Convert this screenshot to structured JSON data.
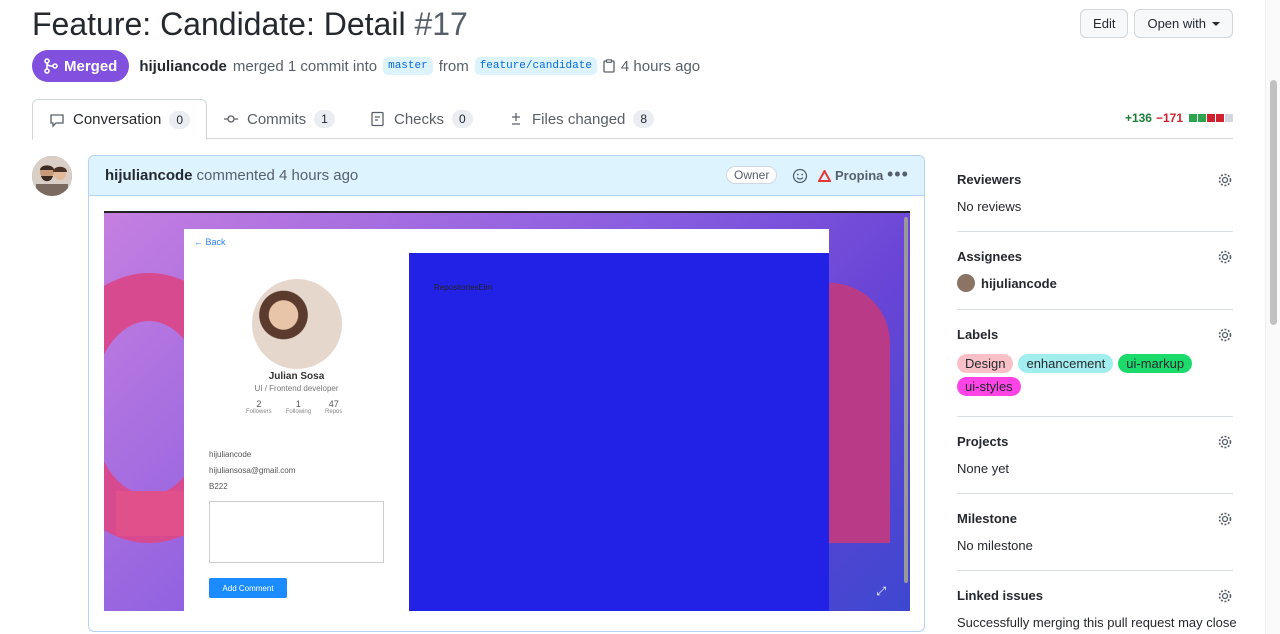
{
  "pr": {
    "title": "Feature: Candidate: Detail",
    "number": "#17",
    "status": "Merged",
    "author": "hijuliancode",
    "action": "merged 1 commit into",
    "base_branch": "master",
    "from_word": "from",
    "head_branch": "feature/candidate",
    "time": "4 hours ago"
  },
  "actions": {
    "edit": "Edit",
    "open_with": "Open with"
  },
  "tabs": [
    {
      "label": "Conversation",
      "count": "0"
    },
    {
      "label": "Commits",
      "count": "1"
    },
    {
      "label": "Checks",
      "count": "0"
    },
    {
      "label": "Files changed",
      "count": "8"
    }
  ],
  "diffstat": {
    "additions": "+136",
    "deletions": "−171"
  },
  "comment": {
    "author": "hijuliancode",
    "meta": "commented 4 hours ago",
    "badge": "Owner",
    "sponsor": "Propina",
    "screenshot": {
      "back": "← Back",
      "repos_text": "RepositoriesElm",
      "name": "Julian Sosa",
      "role": "UI / Frontend developer",
      "stats": [
        {
          "value": "2",
          "label": "Followers"
        },
        {
          "value": "1",
          "label": "Following"
        },
        {
          "value": "47",
          "label": "Repos"
        }
      ],
      "info": [
        "hijuliancode",
        "hijuliansosa@gmail.com",
        "B222"
      ],
      "button": "Add Comment"
    }
  },
  "sidebar": {
    "reviewers": {
      "title": "Reviewers",
      "value": "No reviews"
    },
    "assignees": {
      "title": "Assignees",
      "value": "hijuliancode"
    },
    "labels": {
      "title": "Labels",
      "items": [
        {
          "name": "Design",
          "color": "#f9c0c7"
        },
        {
          "name": "enhancement",
          "color": "#a2eeef"
        },
        {
          "name": "ui-markup",
          "color": "#1adb6b"
        },
        {
          "name": "ui-styles",
          "color": "#ff44e6"
        }
      ]
    },
    "projects": {
      "title": "Projects",
      "value": "None yet"
    },
    "milestone": {
      "title": "Milestone",
      "value": "No milestone"
    },
    "linked": {
      "title": "Linked issues",
      "value": "Successfully merging this pull request may close"
    }
  },
  "colors": {
    "merged": "#8250df",
    "add": "#1a7f37",
    "del": "#cf222e"
  }
}
